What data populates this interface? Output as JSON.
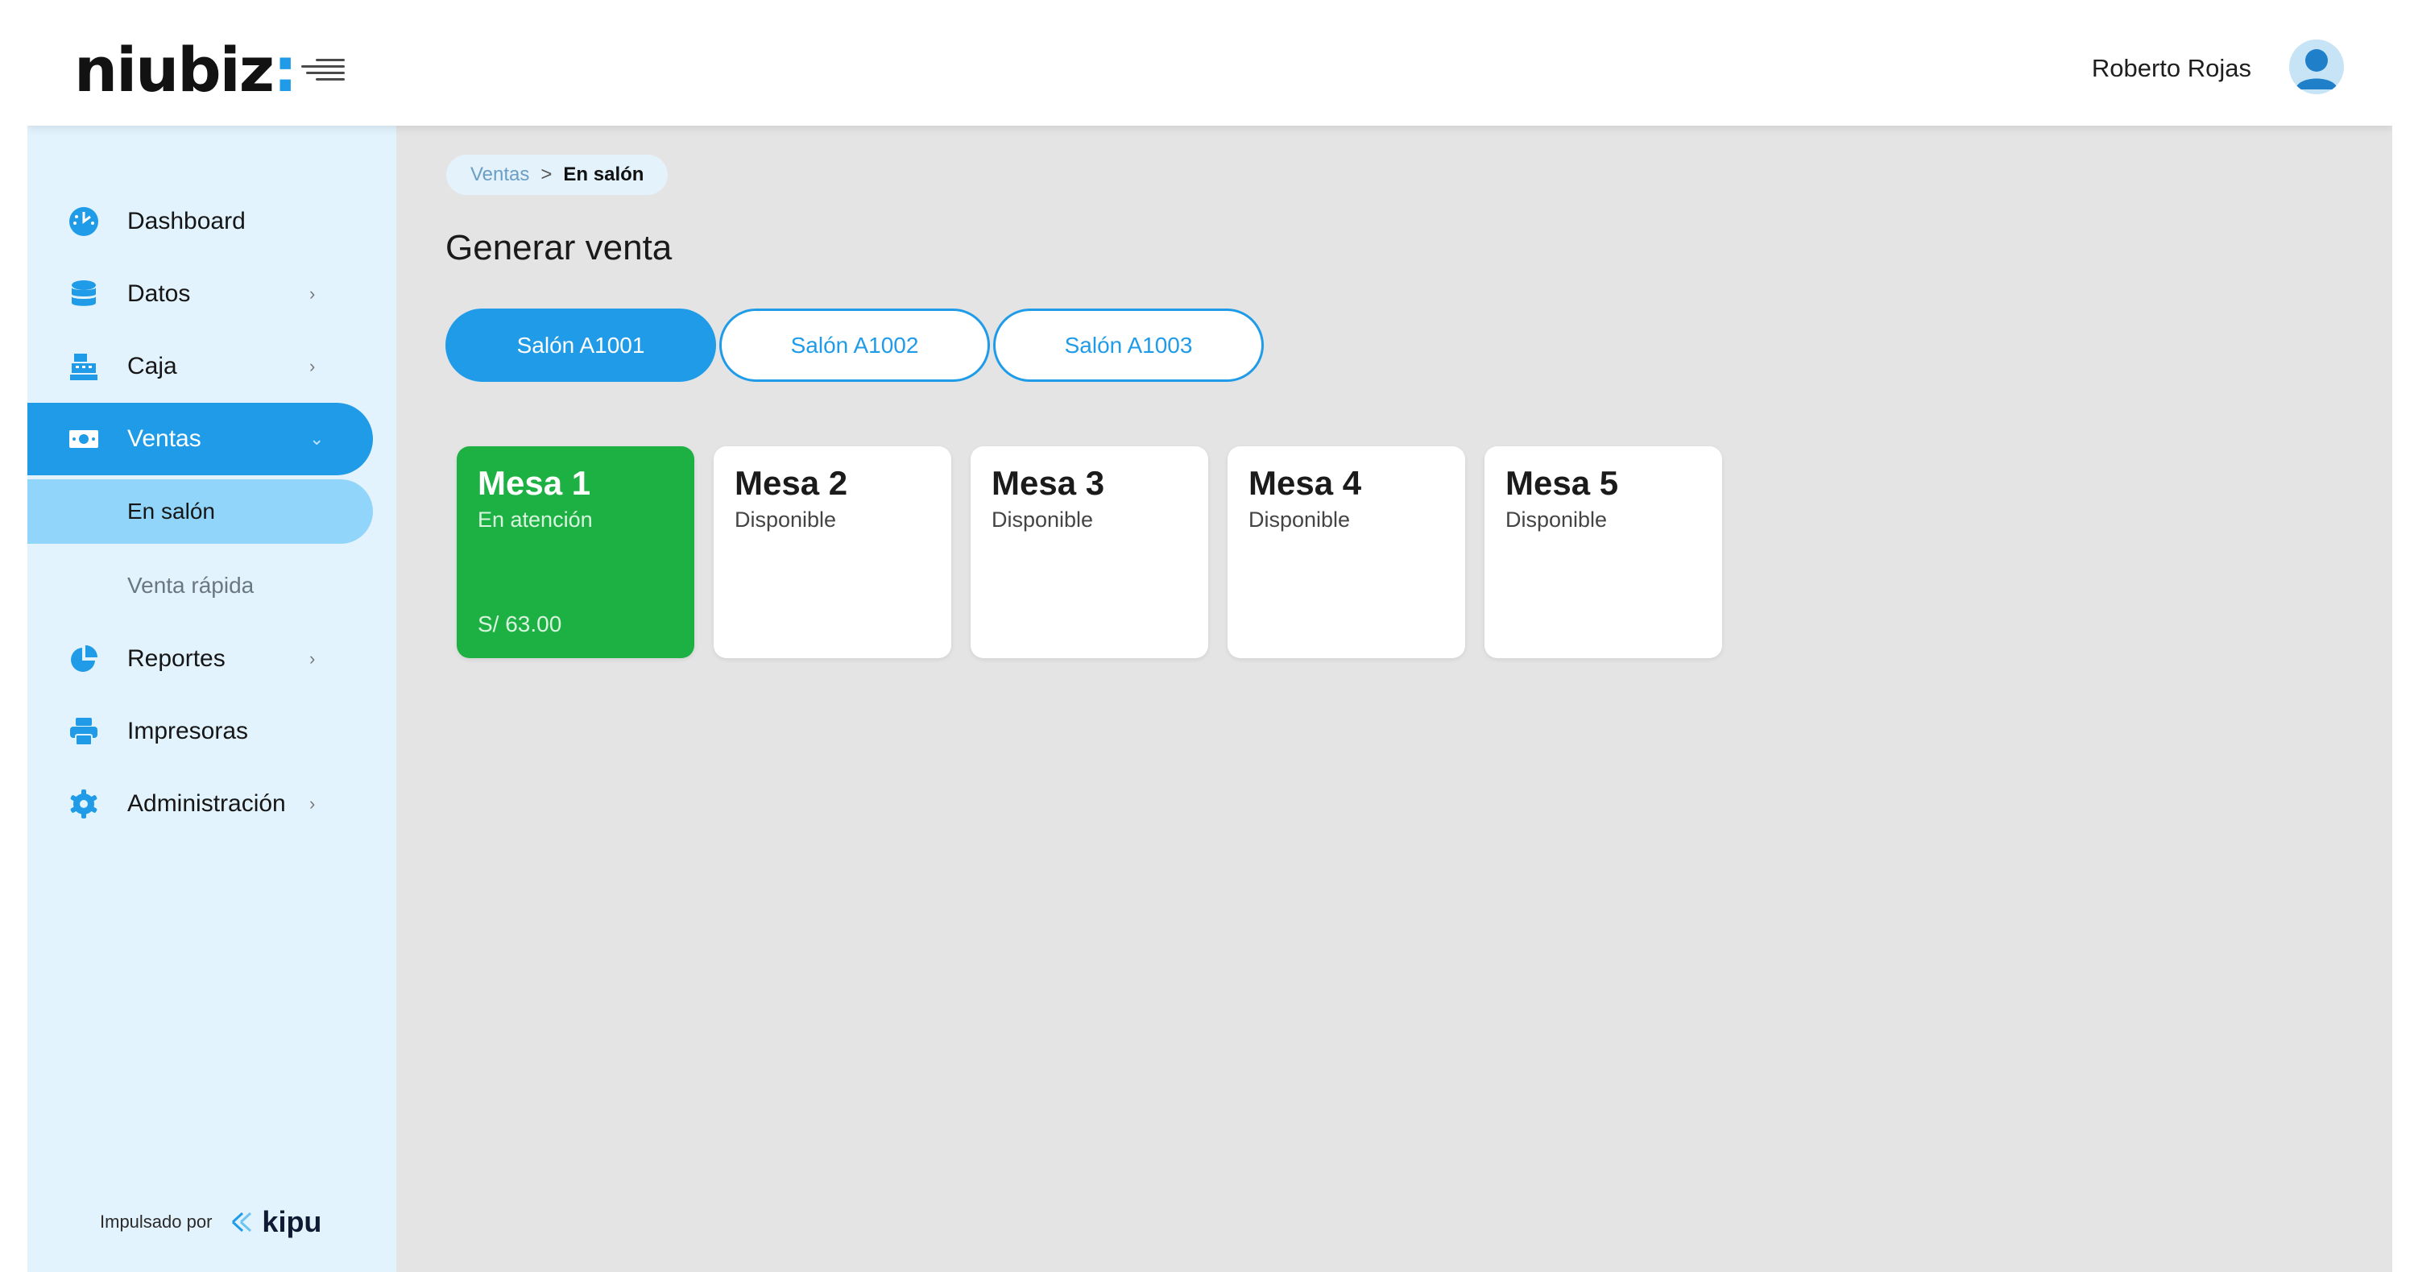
{
  "header": {
    "logo_text": "niubiz",
    "logo_colon": ":",
    "user_name": "Roberto Rojas"
  },
  "sidebar": {
    "items": [
      {
        "label": "Dashboard",
        "icon": "dashboard-gauge-icon"
      },
      {
        "label": "Datos",
        "icon": "database-icon",
        "chevron": "›"
      },
      {
        "label": "Caja",
        "icon": "cash-register-icon",
        "chevron": "›"
      },
      {
        "label": "Ventas",
        "icon": "money-bill-icon",
        "chevron": "⌄"
      },
      {
        "label": "Reportes",
        "icon": "pie-chart-icon",
        "chevron": "›"
      },
      {
        "label": "Impresoras",
        "icon": "printer-icon"
      },
      {
        "label": "Administración",
        "icon": "gear-icon",
        "chevron": "›"
      }
    ],
    "subitems": [
      {
        "label": "En salón"
      },
      {
        "label": "Venta rápida"
      }
    ],
    "powered_by": "Impulsado por",
    "brand": "kipu"
  },
  "breadcrumb": {
    "parent": "Ventas",
    "separator": ">",
    "current": "En salón"
  },
  "page_title": "Generar venta",
  "tabs": [
    {
      "label": "Salón A1001",
      "active": true
    },
    {
      "label": "Salón A1002",
      "active": false
    },
    {
      "label": "Salón A1003",
      "active": false
    }
  ],
  "tables": [
    {
      "name": "Mesa 1",
      "status": "En atención",
      "amount": "S/  63.00",
      "busy": true
    },
    {
      "name": "Mesa 2",
      "status": "Disponible"
    },
    {
      "name": "Mesa 3",
      "status": "Disponible"
    },
    {
      "name": "Mesa 4",
      "status": "Disponible"
    },
    {
      "name": "Mesa 5",
      "status": "Disponible"
    }
  ],
  "colors": {
    "accent": "#1f9be8",
    "sidebar_bg": "#e3f3fd",
    "busy_green": "#1db043",
    "main_bg": "#e4e4e4"
  }
}
